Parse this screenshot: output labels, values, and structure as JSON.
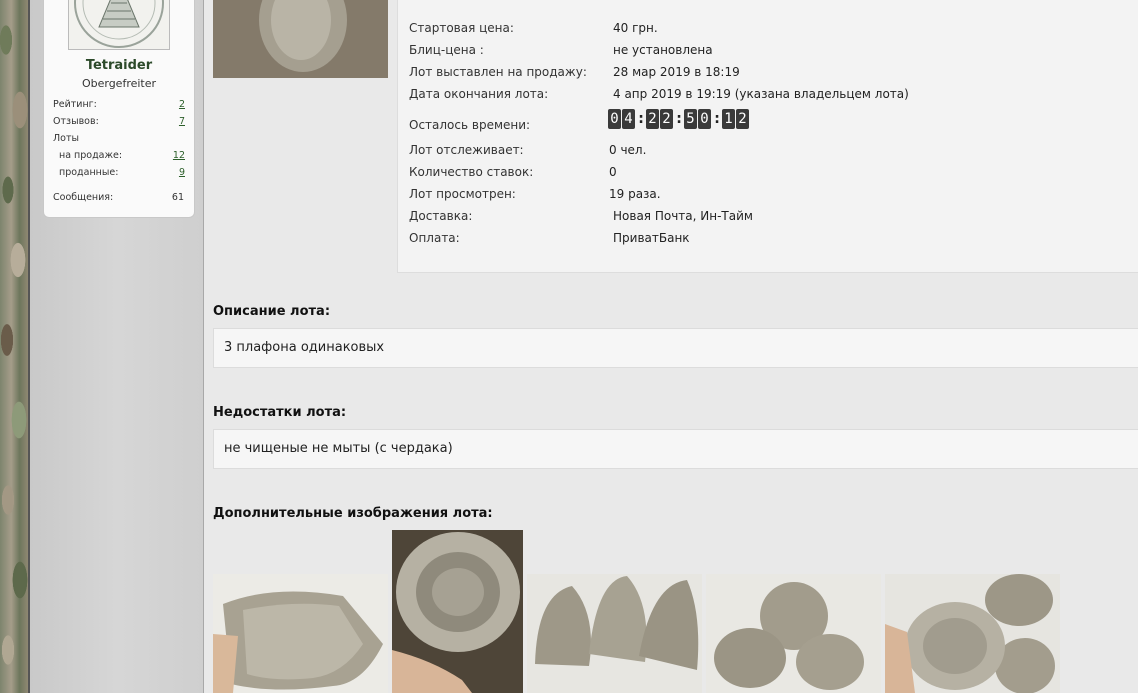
{
  "user": {
    "name": "Tetraider",
    "rank": "Obergefreiter",
    "stats": {
      "rating_label": "Рейтинг:",
      "rating_value": "2",
      "reviews_label": "Отзывов:",
      "reviews_value": "7",
      "lots_label": "Лоты",
      "on_sale_label": "на продаже:",
      "on_sale_value": "12",
      "sold_label": "проданные:",
      "sold_value": "9",
      "messages_label": "Сообщения:",
      "messages_value": "61"
    }
  },
  "lot": {
    "start_price_label": "Стартовая цена:",
    "start_price_value": "40 грн.",
    "blitz_label": "Блиц-цена :",
    "blitz_value": "не установлена",
    "listed_label": "Лот выставлен на продажу:",
    "listed_value": "28 мар 2019 в 18:19",
    "end_label": "Дата окончания лота:",
    "end_value": "4 апр 2019 в 19:19 (указана владельцем лота)",
    "time_left_label": "Осталось времени:",
    "timer": {
      "d1": "0",
      "d2": "4",
      "d3": "2",
      "d4": "2",
      "d5": "5",
      "d6": "0",
      "d7": "1",
      "d8": "2",
      "sep": ":"
    },
    "watchers_label": "Лот отслеживает:",
    "watchers_value": "0 чел.",
    "bids_label": "Количество ставок:",
    "bids_value": "0",
    "views_label": "Лот просмотрен:",
    "views_value": "19 раза.",
    "delivery_label": "Доставка:",
    "delivery_value": "Новая Почта, Ин-Тайм",
    "payment_label": "Оплата:",
    "payment_value": "ПриватБанк"
  },
  "description": {
    "title": "Описание лота:",
    "text": "3 плафона одинаковых"
  },
  "flaws": {
    "title": "Недостатки лота:",
    "text": "не чищеные не мыты (с чердака)"
  },
  "gallery": {
    "title": "Дополнительные изображения лота:"
  }
}
